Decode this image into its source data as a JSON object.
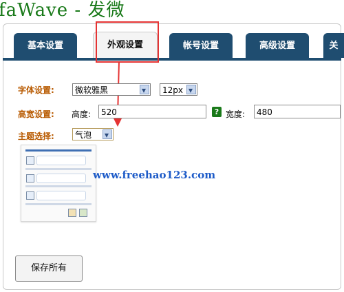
{
  "app": {
    "title": "faWave - 发微"
  },
  "tabs": [
    {
      "label": "基本设置"
    },
    {
      "label": "外观设置"
    },
    {
      "label": "帐号设置"
    },
    {
      "label": "高级设置"
    },
    {
      "label": "关"
    }
  ],
  "settings": {
    "font": {
      "label": "字体设置:",
      "family": "微软雅黑",
      "size": "12px"
    },
    "dimensions": {
      "label": "高宽设置:",
      "height_label": "高度:",
      "height_value": "520",
      "width_label": "宽度:",
      "width_value": "480",
      "help": "?"
    },
    "theme": {
      "label": "主题选择:",
      "value": "气泡"
    }
  },
  "watermark": "www.freehao123.com",
  "actions": {
    "save_all_label": "保存所有"
  },
  "colors": {
    "tab_bg": "#1f4d70",
    "label": "#b85a00",
    "accent_green": "#1a7a1a",
    "highlight": "#e53333"
  }
}
